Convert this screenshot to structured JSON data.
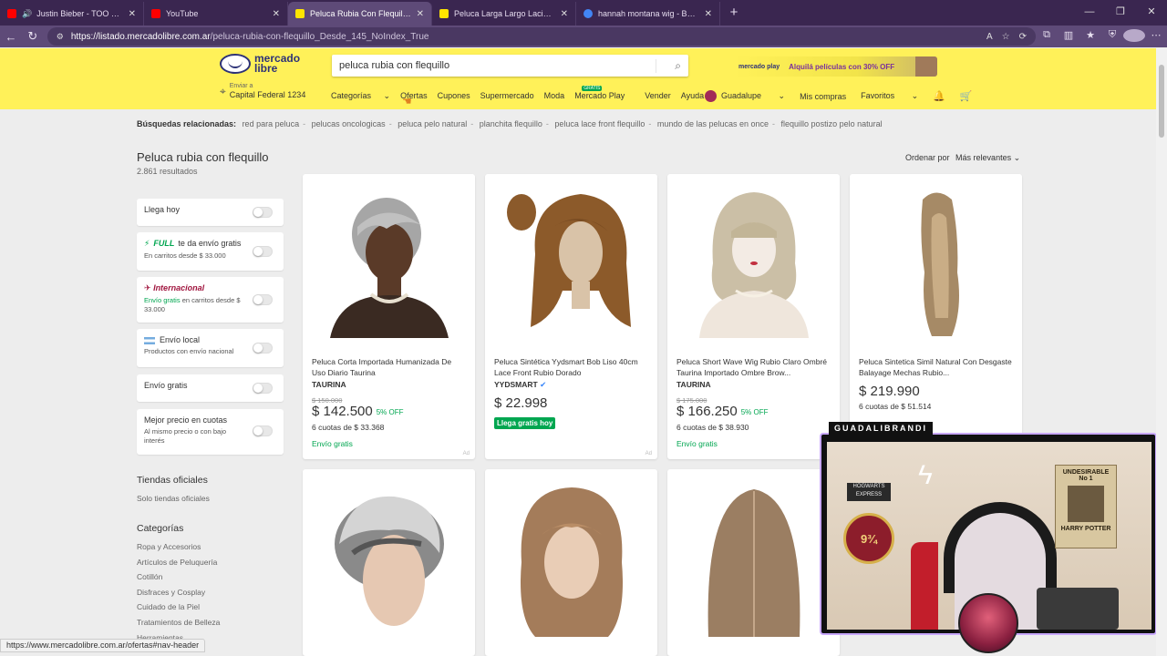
{
  "browser": {
    "tabs": [
      {
        "title": "Justin Bieber - TOO LONG (Au",
        "favicon_color": "#ff0000",
        "audio": "🔊",
        "active": false
      },
      {
        "title": "YouTube",
        "favicon_color": "#ff0000",
        "audio": "",
        "active": false
      },
      {
        "title": "Peluca Rubia Con Flequillo | Merca",
        "favicon_color": "#ffe600",
        "audio": "",
        "active": true
      },
      {
        "title": "Peluca Larga Largo Lacia Lacio Var",
        "favicon_color": "#ffe600",
        "audio": "",
        "active": false
      },
      {
        "title": "hannah montana wig - Buscar con",
        "favicon_color": "#4285f4",
        "audio": "",
        "active": false
      }
    ],
    "url_host": "https://listado.mercadolibre.com.ar",
    "url_path": "/peluca-rubia-con-flequillo_Desde_145_NoIndex_True",
    "status_url": "https://www.mercadolibre.com.ar/ofertas#nav-header"
  },
  "header": {
    "logo_line1": "mercado",
    "logo_line2": "libre",
    "search_value": "peluca rubia con flequillo",
    "promo_brand": "mercado play",
    "promo_text": "Alquilá películas con 30% OFF",
    "location_line1": "Enviar a",
    "location_line2": "Capital Federal 1234",
    "nav": [
      "Categorías",
      "Ofertas",
      "Cupones",
      "Supermercado",
      "Moda",
      "Mercado Play",
      "Vender",
      "Ayuda"
    ],
    "nav_badge": "GRATIS",
    "user": "Guadalupe",
    "my_purchases": "Mis compras",
    "favorites": "Favoritos"
  },
  "related": {
    "label": "Búsquedas relacionadas:",
    "items": [
      "red para peluca",
      "pelucas oncologicas",
      "peluca pelo natural",
      "planchita flequillo",
      "peluca lace front flequillo",
      "mundo de las pelucas en once",
      "flequillo postizo pelo natural"
    ]
  },
  "results": {
    "title": "Peluca rubia con flequillo",
    "count": "2.861 resultados",
    "sort_label": "Ordenar por",
    "sort_value": "Más relevantes"
  },
  "filters": [
    {
      "title": "Llega hoy",
      "sub": ""
    },
    {
      "tag": "FULL",
      "title": "te da envío gratis",
      "sub": "En carritos desde $ 33.000"
    },
    {
      "tag": "Internacional",
      "title": "",
      "sub_green": "Envío gratis",
      "sub": "en carritos desde $ 33.000"
    },
    {
      "title": "Envío local",
      "sub": "Productos con envío nacional"
    },
    {
      "title": "Envío gratis",
      "sub": ""
    },
    {
      "title": "Mejor precio en cuotas",
      "sub": "Al mismo precio o con bajo interés"
    }
  ],
  "sidebar": {
    "official_title": "Tiendas oficiales",
    "official_link": "Solo tiendas oficiales",
    "categories_title": "Categorías",
    "categories": [
      "Ropa y Accesorios",
      "Artículos de Peluquería",
      "Cotillón",
      "Disfraces y Cosplay",
      "Cuidado de la Piel",
      "Tratamientos de Belleza",
      "Herramientas"
    ]
  },
  "products": [
    {
      "title": "Peluca Corta Importada Humanizada De Uso Diario Taurina",
      "seller": "TAURINA",
      "old_price": "$ 150.000",
      "price": "$ 142.500",
      "off": "5% OFF",
      "installments": "6 cuotas de $ 33.368",
      "shipping": "Envío gratis",
      "ad": "Ad"
    },
    {
      "title": "Peluca Sintética Yydsmart Bob Liso 40cm Lace Front Rubio Dorado",
      "seller": "YYDSMART",
      "old_price": "",
      "price": "$ 22.998",
      "off": "",
      "installments": "",
      "shipping": "Llega gratis hoy",
      "ad": "Ad"
    },
    {
      "title": "Peluca Short Wave Wig Rubio Claro Ombré Taurina Importado Ombre Brow...",
      "seller": "TAURINA",
      "old_price": "$ 175.000",
      "price": "$ 166.250",
      "off": "5% OFF",
      "installments": "6 cuotas de $ 38.930",
      "shipping": "Envío gratis",
      "ad": ""
    },
    {
      "title": "Peluca Sintetica Simil Natural Con Desgaste Balayage Mechas Rubio...",
      "seller": "",
      "old_price": "",
      "price": "$ 219.990",
      "off": "",
      "installments": "6 cuotas de $ 51.514",
      "shipping": "",
      "ad": ""
    }
  ],
  "stream": {
    "name": "GUADALIBRANDI",
    "platform": "9¾",
    "hogwarts": "HOGWARTS EXPRESS",
    "wanted_line1": "UNDESIRABLE",
    "wanted_line2": "No 1",
    "wanted_line3": "HARRY POTTER"
  },
  "colors": {
    "ml_yellow": "#fff159",
    "ml_blue": "#2d3277",
    "green": "#00a650"
  }
}
